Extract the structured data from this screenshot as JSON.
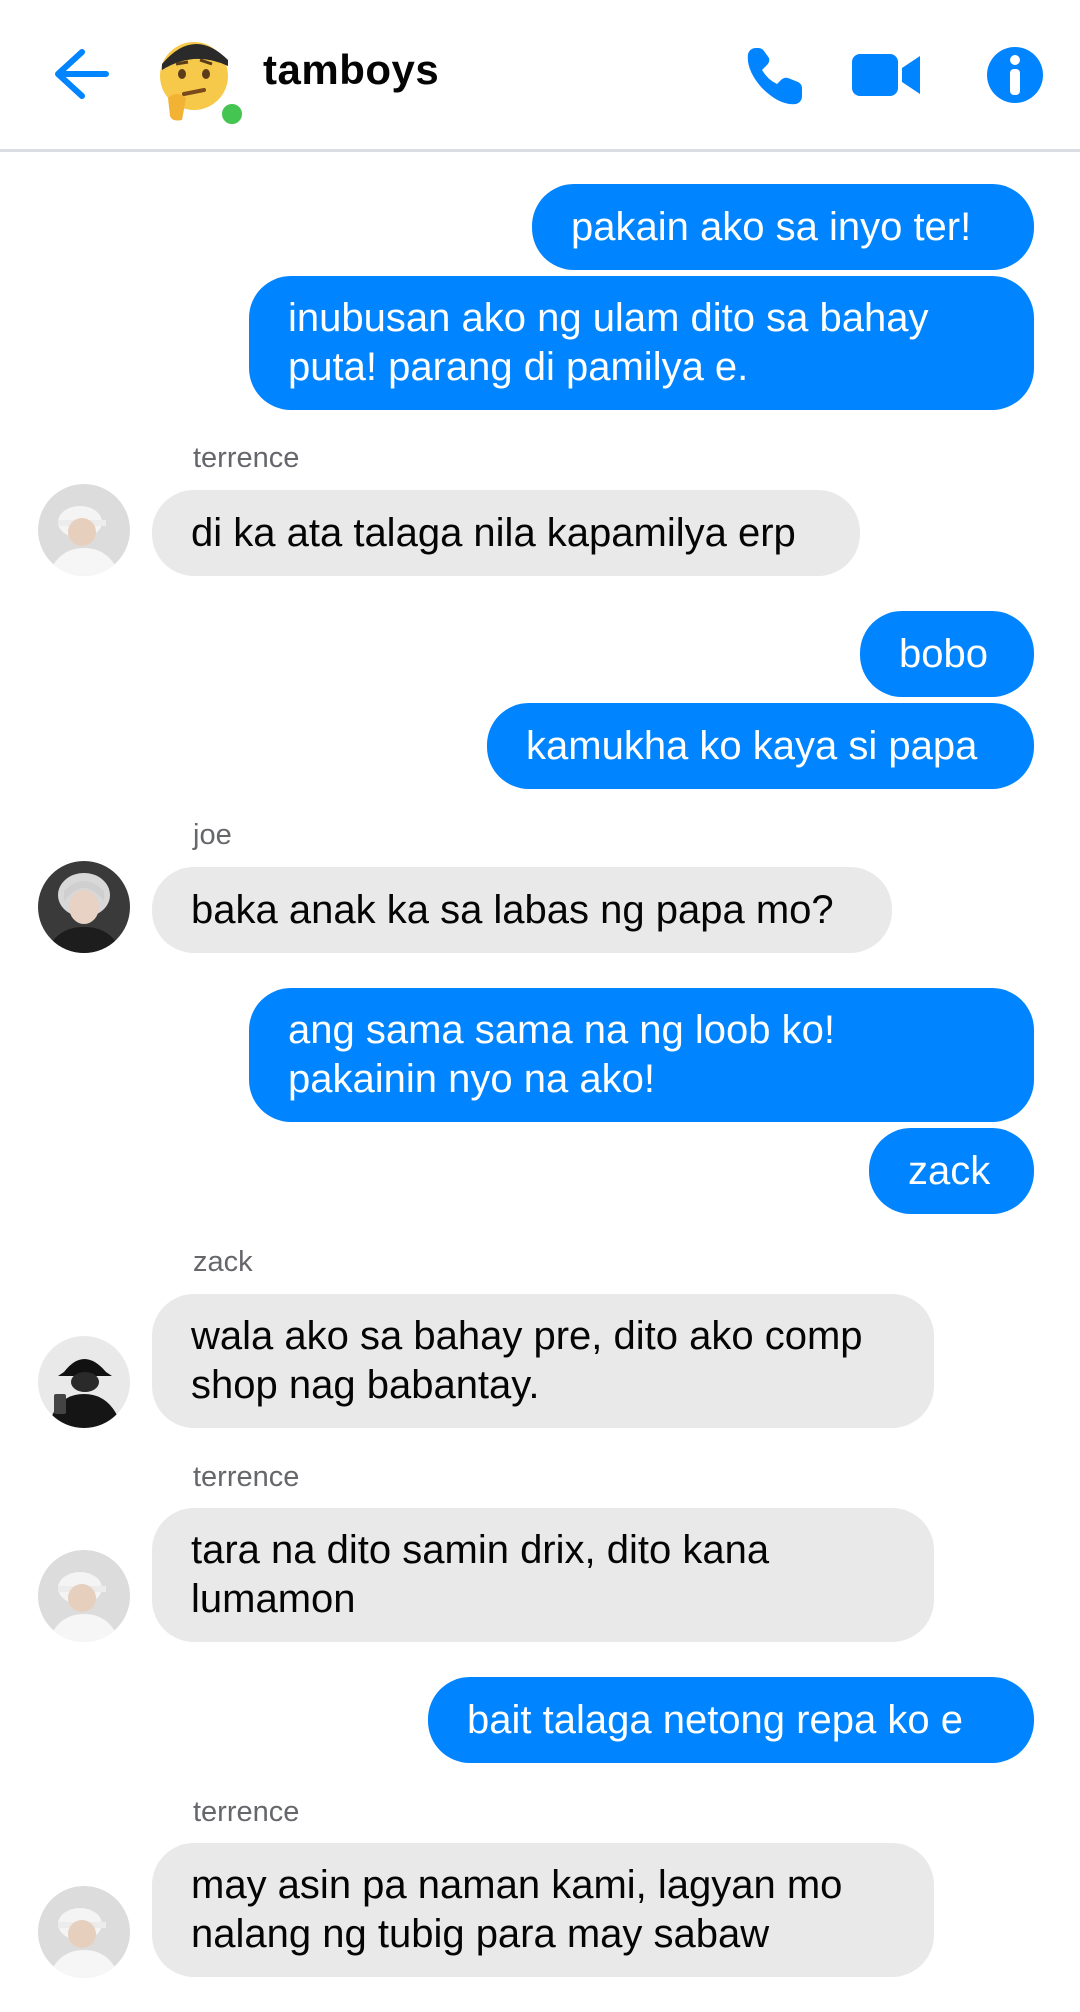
{
  "colors": {
    "accent": "#0084ff",
    "incoming_bubble": "#e9e9e9",
    "online": "#44c552",
    "sender_name": "#65676b"
  },
  "header": {
    "title": "tamboys",
    "avatar": "thinking-emoji-cap-avatar",
    "icons": {
      "back": "back-arrow-icon",
      "call": "phone-icon",
      "video": "video-camera-icon",
      "info": "info-icon"
    }
  },
  "messages": [
    {
      "side": "out",
      "text": "pakain ako sa inyo ter!"
    },
    {
      "side": "out",
      "text": "inubusan ako ng ulam dito sa bahay\nputa! parang di pamilya e."
    },
    {
      "side": "in",
      "sender": "terrence",
      "text": "di ka ata talaga nila kapamilya erp"
    },
    {
      "side": "out",
      "text": "bobo"
    },
    {
      "side": "out",
      "text": "kamukha ko kaya si papa"
    },
    {
      "side": "in",
      "sender": "joe",
      "text": "baka anak ka sa labas ng papa mo?"
    },
    {
      "side": "out",
      "text": "ang sama sama na ng loob ko!\npakainin nyo na ako!"
    },
    {
      "side": "out",
      "text": "zack"
    },
    {
      "side": "in",
      "sender": "zack",
      "text": "wala ako sa bahay pre, dito ako comp\nshop nag babantay."
    },
    {
      "side": "in",
      "sender": "terrence",
      "text": "tara na dito samin drix, dito kana\nlumamon"
    },
    {
      "side": "out",
      "text": "bait talaga netong repa ko e"
    },
    {
      "side": "in",
      "sender": "terrence",
      "text": "may asin pa naman kami, lagyan mo\nnalang ng tubig para may sabaw"
    }
  ]
}
